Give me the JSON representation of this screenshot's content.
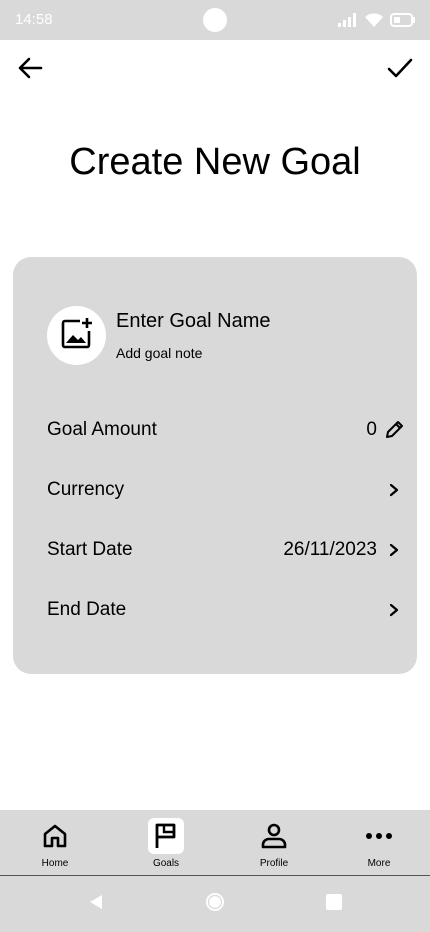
{
  "status_bar": {
    "time": "14:58"
  },
  "title": "Create New Goal",
  "goal": {
    "name_placeholder": "Enter Goal Name",
    "note_placeholder": "Add goal note"
  },
  "fields": {
    "amount": {
      "label": "Goal Amount",
      "value": "0"
    },
    "currency": {
      "label": "Currency",
      "value": ""
    },
    "start_date": {
      "label": "Start Date",
      "value": "26/11/2023"
    },
    "end_date": {
      "label": "End Date",
      "value": ""
    }
  },
  "nav": {
    "home": "Home",
    "goals": "Goals",
    "profile": "Profile",
    "more": "More",
    "active": "goals"
  },
  "colors": {
    "surface": "#d9d9d9",
    "background": "#ffffff",
    "text": "#000000"
  }
}
